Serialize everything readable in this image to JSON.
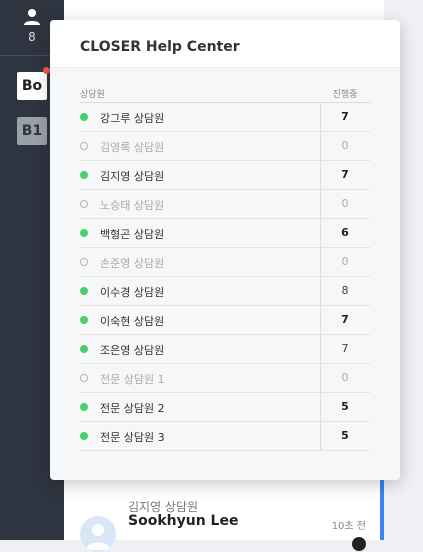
{
  "rail": {
    "agent_count": "8",
    "brand_label": "Bo",
    "workspace_label": "B1"
  },
  "popover": {
    "title": "CLOSER Help Center",
    "headers": {
      "agent": "상담원",
      "count": "진행중"
    },
    "rows": [
      {
        "name": "강그루 상담원",
        "count": "7",
        "online": true,
        "bold": true
      },
      {
        "name": "김영록 상담원",
        "count": "0",
        "online": false,
        "bold": false
      },
      {
        "name": "김지영 상담원",
        "count": "7",
        "online": true,
        "bold": true
      },
      {
        "name": "노승태 상담원",
        "count": "0",
        "online": false,
        "bold": false
      },
      {
        "name": "백형곤 상담원",
        "count": "6",
        "online": true,
        "bold": true
      },
      {
        "name": "손준영 상담원",
        "count": "0",
        "online": false,
        "bold": false
      },
      {
        "name": "이수경 상담원",
        "count": "8",
        "online": true,
        "bold": false
      },
      {
        "name": "이숙현 상담원",
        "count": "7",
        "online": true,
        "bold": true
      },
      {
        "name": "조은영 상담원",
        "count": "7",
        "online": true,
        "bold": false
      },
      {
        "name": "전문 상담원 1",
        "count": "0",
        "online": false,
        "bold": false
      },
      {
        "name": "전문 상담원 2",
        "count": "5",
        "online": true,
        "bold": true
      },
      {
        "name": "전문 상담원 3",
        "count": "5",
        "online": true,
        "bold": true
      }
    ]
  },
  "chat_item": {
    "agent": "김지영 상담원",
    "customer": "Sookhyun Lee",
    "time": "10초 전"
  },
  "colors": {
    "rail": "#2f3540",
    "online": "#4cce6e",
    "accent": "#3b82f6",
    "notify": "#f05a50"
  }
}
